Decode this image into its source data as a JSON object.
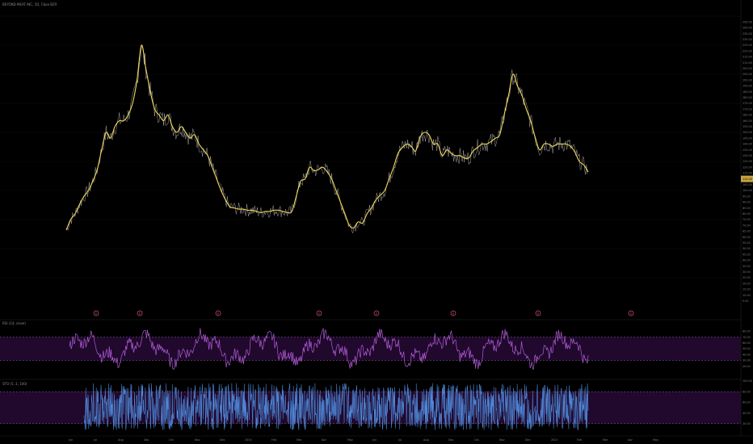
{
  "header": {
    "symbol_title": "BEYOND MEAT INC, 1D, Cboe BZX"
  },
  "panes": {
    "rsi_label": "RSI (14, close)",
    "stoch_label": "STO (5, 3, 100)"
  },
  "colors": {
    "background": "#000000",
    "price_thin": "#d9d9d9",
    "price_smooth": "#f2d95c",
    "rsi_line": "#b15bd6",
    "rsi_band": "#3a1152",
    "stoch_line": "#4e86d6",
    "stoch_band": "#3a1152",
    "marker": "#d04f8a",
    "price_badge": "#c9a53f",
    "axis_text": "#7d7d7d"
  },
  "price_axis_ticks": [
    "245.00",
    "240.00",
    "235.00",
    "230.00",
    "225.00",
    "220.00",
    "215.00",
    "210.00",
    "205.00",
    "200.00",
    "195.00",
    "190.00",
    "185.00",
    "180.00",
    "175.00",
    "170.00",
    "165.00",
    "160.00",
    "155.00",
    "150.00",
    "145.00",
    "140.00",
    "135.00",
    "130.00",
    "125.00",
    "120.00",
    "115.00",
    "110.00",
    "105.00",
    "100.00",
    "95.00",
    "90.00",
    "85.00",
    "80.00",
    "75.00",
    "70.00",
    "65.00",
    "60.00",
    "55.00",
    "50.00",
    "45.00",
    "40.00",
    "35.00",
    "30.00",
    "25.00",
    "20.00",
    "15.00",
    "10.00",
    "5.00"
  ],
  "current_price_label": "110.00",
  "rsi_axis_ticks": [
    "80.00",
    "70.00",
    "60.00",
    "50.00",
    "40.00",
    "30.00",
    "20.00"
  ],
  "stoch_axis_ticks": [
    "100.00",
    "80.00",
    "60.00",
    "40.00",
    "20.00"
  ],
  "time_axis_ticks": [
    "Jun",
    "Jul",
    "Aug",
    "Sep",
    "Oct",
    "Nov",
    "Dec",
    "2020",
    "Feb",
    "Mar",
    "Apr",
    "May",
    "Jun",
    "Jul",
    "Aug",
    "Sep",
    "Oct",
    "Nov",
    "Dec",
    "2021",
    "Feb",
    "Mar",
    "Apr",
    "May"
  ],
  "event_markers": [
    "E",
    "E",
    "E",
    "E",
    "E",
    "E",
    "E",
    "E"
  ],
  "chart_data": {
    "type": "line",
    "title": "BEYOND MEAT INC, 1D, Cboe BZX",
    "ylim": [
      0,
      250
    ],
    "x_start": "2019-05",
    "x_end": "2021-05",
    "series": [
      {
        "name": "Close",
        "values": [
          66,
          75,
          80,
          88,
          95,
          100,
          108,
          118,
          135,
          150,
          145,
          155,
          160,
          160,
          165,
          175,
          195,
          225,
          205,
          185,
          170,
          165,
          160,
          165,
          155,
          150,
          155,
          150,
          145,
          148,
          140,
          135,
          130,
          120,
          110,
          100,
          92,
          86,
          85,
          84,
          84,
          83,
          83,
          82,
          81,
          82,
          82,
          83,
          83,
          82,
          81,
          82,
          95,
          108,
          110,
          120,
          117,
          118,
          120,
          116,
          110,
          100,
          90,
          80,
          70,
          68,
          73,
          72,
          80,
          85,
          92,
          96,
          100,
          110,
          120,
          132,
          137,
          140,
          138,
          134,
          146,
          150,
          148,
          140,
          140,
          130,
          135,
          132,
          130,
          130,
          128,
          128,
          134,
          137,
          140,
          140,
          142,
          145,
          148,
          165,
          182,
          200,
          190,
          182,
          170,
          160,
          146,
          135,
          140,
          140,
          138,
          140,
          140,
          140,
          138,
          133,
          125,
          122,
          116
        ]
      }
    ],
    "rsi": {
      "ylim": [
        0,
        100
      ],
      "bands": [
        30,
        70
      ]
    },
    "stoch": {
      "ylim": [
        0,
        100
      ],
      "bands": [
        20,
        80
      ]
    }
  }
}
